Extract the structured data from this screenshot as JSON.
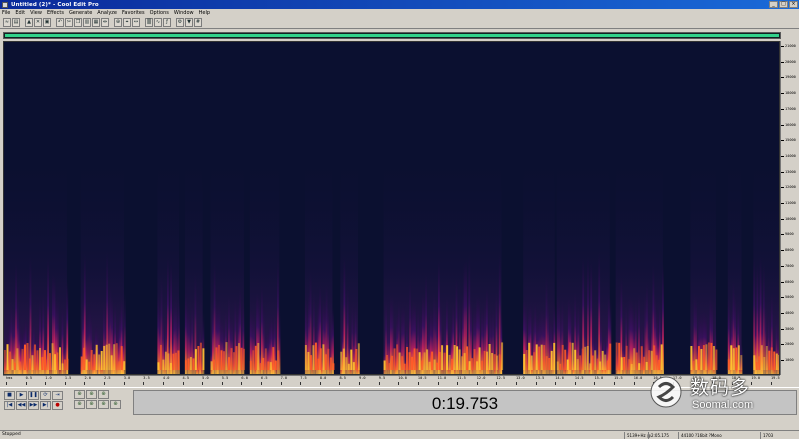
{
  "window": {
    "title": "Untitled (2)* - Cool Edit Pro"
  },
  "menu": [
    "File",
    "Edit",
    "View",
    "Effects",
    "Generate",
    "Analyze",
    "Favorites",
    "Options",
    "Window",
    "Help"
  ],
  "toolbar": {
    "buttons": [
      "wave-icon",
      "multitrack-icon",
      "open-icon",
      "close-icon",
      "save-icon",
      "undo-icon",
      "cut-icon",
      "copy-icon",
      "paste-icon",
      "mix-paste-icon",
      "trim-icon",
      "zoom-icon",
      "select-icon",
      "scrub-icon",
      "spectral-icon",
      "envelope-icon",
      "frequency-icon",
      "settings-icon",
      "cue-icon",
      "snap-icon"
    ]
  },
  "frequency_axis": {
    "labels": [
      "21000",
      "20000",
      "19000",
      "18000",
      "17000",
      "16000",
      "15000",
      "14000",
      "13000",
      "12000",
      "11000",
      "10000",
      "9000",
      "8000",
      "7000",
      "6000",
      "5000",
      "4000",
      "3000",
      "2000",
      "1000"
    ]
  },
  "time_ruler": {
    "labels": [
      "hms",
      "0.5",
      "1.0",
      "1.5",
      "2.0",
      "2.5",
      "3.0",
      "3.5",
      "4.0",
      "4.5",
      "5.0",
      "5.5",
      "6.0",
      "6.5",
      "7.0",
      "7.5",
      "8.0",
      "8.5",
      "9.0",
      "9.5",
      "10.0",
      "10.5",
      "11.0",
      "11.5",
      "12.0",
      "12.5",
      "13.0",
      "13.5",
      "14.0",
      "14.5",
      "15.0",
      "15.5",
      "16.0",
      "16.5",
      "17.0",
      "17.5",
      "18.0",
      "18.5",
      "19.0",
      "19.5"
    ]
  },
  "transport": {
    "row1": [
      "stop-icon",
      "play-icon",
      "pause-icon",
      "play-looped-icon",
      "play-to-end-icon"
    ],
    "row2": [
      "go-start-icon",
      "rewind-icon",
      "fast-forward-icon",
      "go-end-icon",
      "record-icon"
    ]
  },
  "zoom": {
    "row1": [
      "zoom-in-h-icon",
      "zoom-out-h-icon",
      "zoom-full-icon"
    ],
    "row2": [
      "zoom-in-left-icon",
      "zoom-in-right-icon",
      "zoom-in-v-icon",
      "zoom-out-v-icon"
    ]
  },
  "time_display": {
    "value": "0:19.753"
  },
  "watermark": {
    "cn": "数码多",
    "en": "Soomal.com"
  },
  "status": {
    "state": "Stopped",
    "cells": [
      "5139+Hz @",
      "2:05.175",
      "44100 ?16bit ?Mono",
      "1703"
    ]
  },
  "colors": {
    "spectrogram_bg": "#0b1030",
    "selection_bar": "#32d28a",
    "heat_low": "#3b1060",
    "heat_mid": "#c02060",
    "heat_high": "#ffd040"
  },
  "spectrogram": {
    "frequency_max_hz": 22000,
    "duration_s": 19.753,
    "segments_s": [
      [
        0.0,
        1.6
      ],
      [
        1.95,
        3.05
      ],
      [
        3.9,
        4.45
      ],
      [
        4.6,
        5.05
      ],
      [
        5.25,
        6.1
      ],
      [
        6.25,
        7.0
      ],
      [
        7.65,
        8.35
      ],
      [
        8.55,
        9.0
      ],
      [
        9.65,
        12.65
      ],
      [
        13.2,
        14.0
      ],
      [
        14.05,
        15.4
      ],
      [
        15.55,
        16.75
      ],
      [
        17.45,
        18.1
      ],
      [
        18.4,
        18.75
      ],
      [
        19.05,
        19.753
      ]
    ]
  }
}
